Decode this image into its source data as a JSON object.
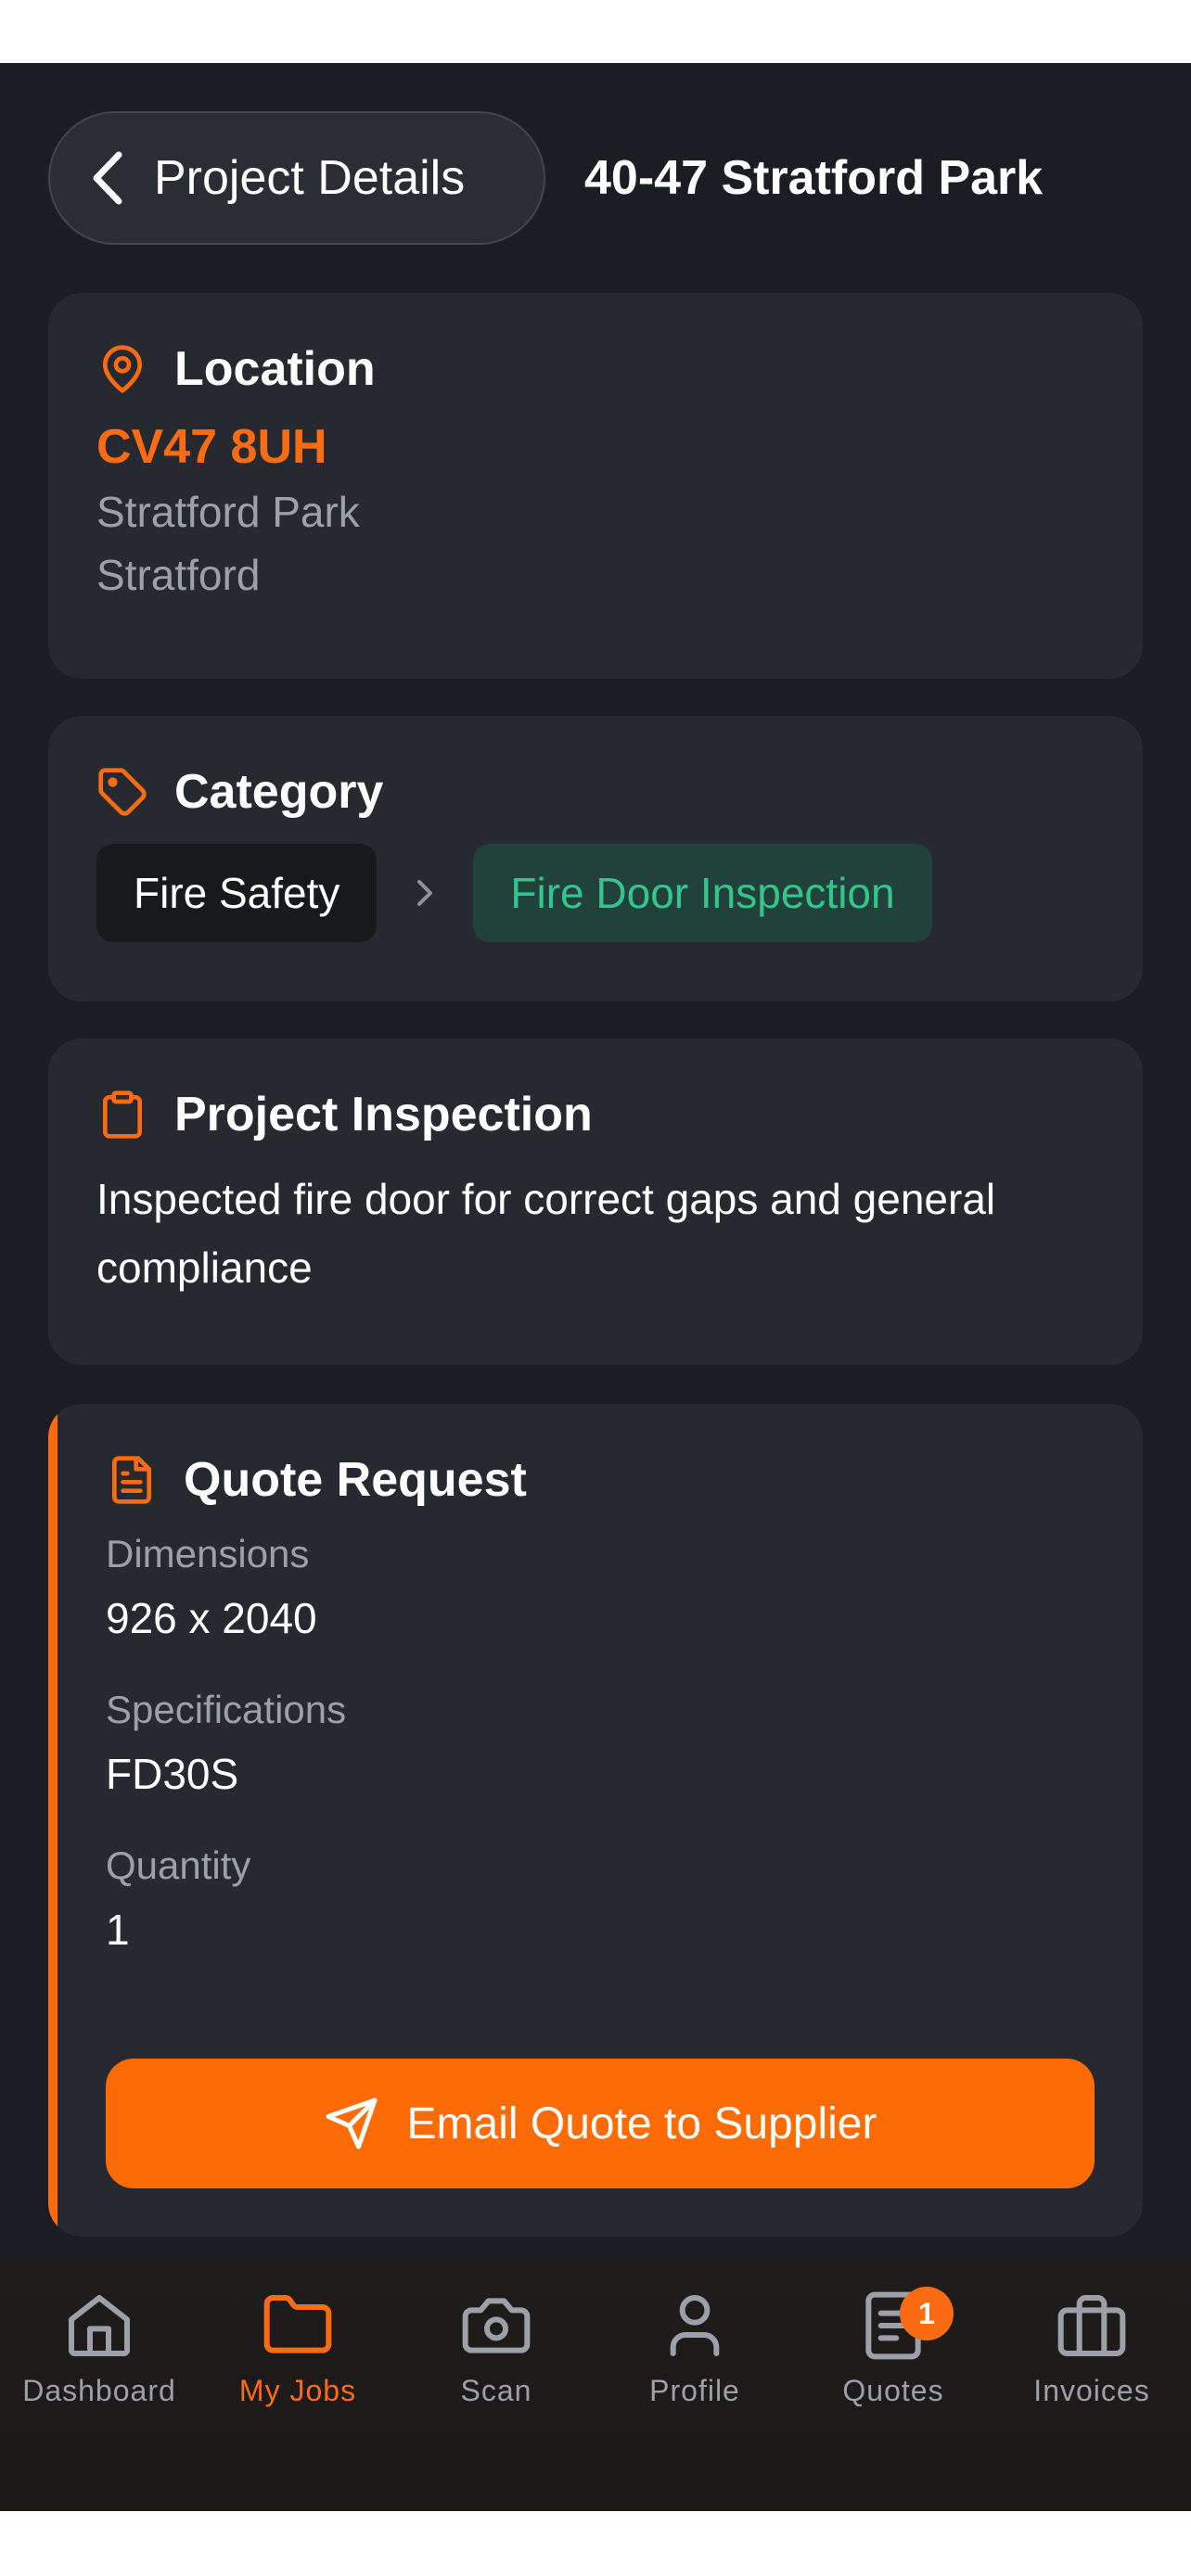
{
  "header": {
    "back_label": "Project Details",
    "title": "40-47 Stratford Park"
  },
  "location": {
    "heading": "Location",
    "postcode": "CV47 8UH",
    "line1": "Stratford Park",
    "line2": "Stratford"
  },
  "category": {
    "heading": "Category",
    "primary": "Fire Safety",
    "secondary": "Fire Door Inspection"
  },
  "inspection": {
    "heading": "Project Inspection",
    "text": "Inspected fire door for correct gaps and general compliance"
  },
  "quote": {
    "heading": "Quote Request",
    "dimensions_label": "Dimensions",
    "dimensions_value": "926 x 2040",
    "specifications_label": "Specifications",
    "specifications_value": "FD30S",
    "quantity_label": "Quantity",
    "quantity_value": "1",
    "button_label": "Email Quote to Supplier"
  },
  "tabs": [
    {
      "label": "Dashboard",
      "icon": "home-icon"
    },
    {
      "label": "My Jobs",
      "icon": "folder-icon",
      "active": true
    },
    {
      "label": "Scan",
      "icon": "camera-icon"
    },
    {
      "label": "Profile",
      "icon": "user-icon"
    },
    {
      "label": "Quotes",
      "icon": "document-icon",
      "badge": "1"
    },
    {
      "label": "Invoices",
      "icon": "briefcase-icon"
    }
  ],
  "colors": {
    "accent": "#fb6c12",
    "background": "#1b1d22",
    "card": "#262930",
    "success": "#34c58d"
  }
}
